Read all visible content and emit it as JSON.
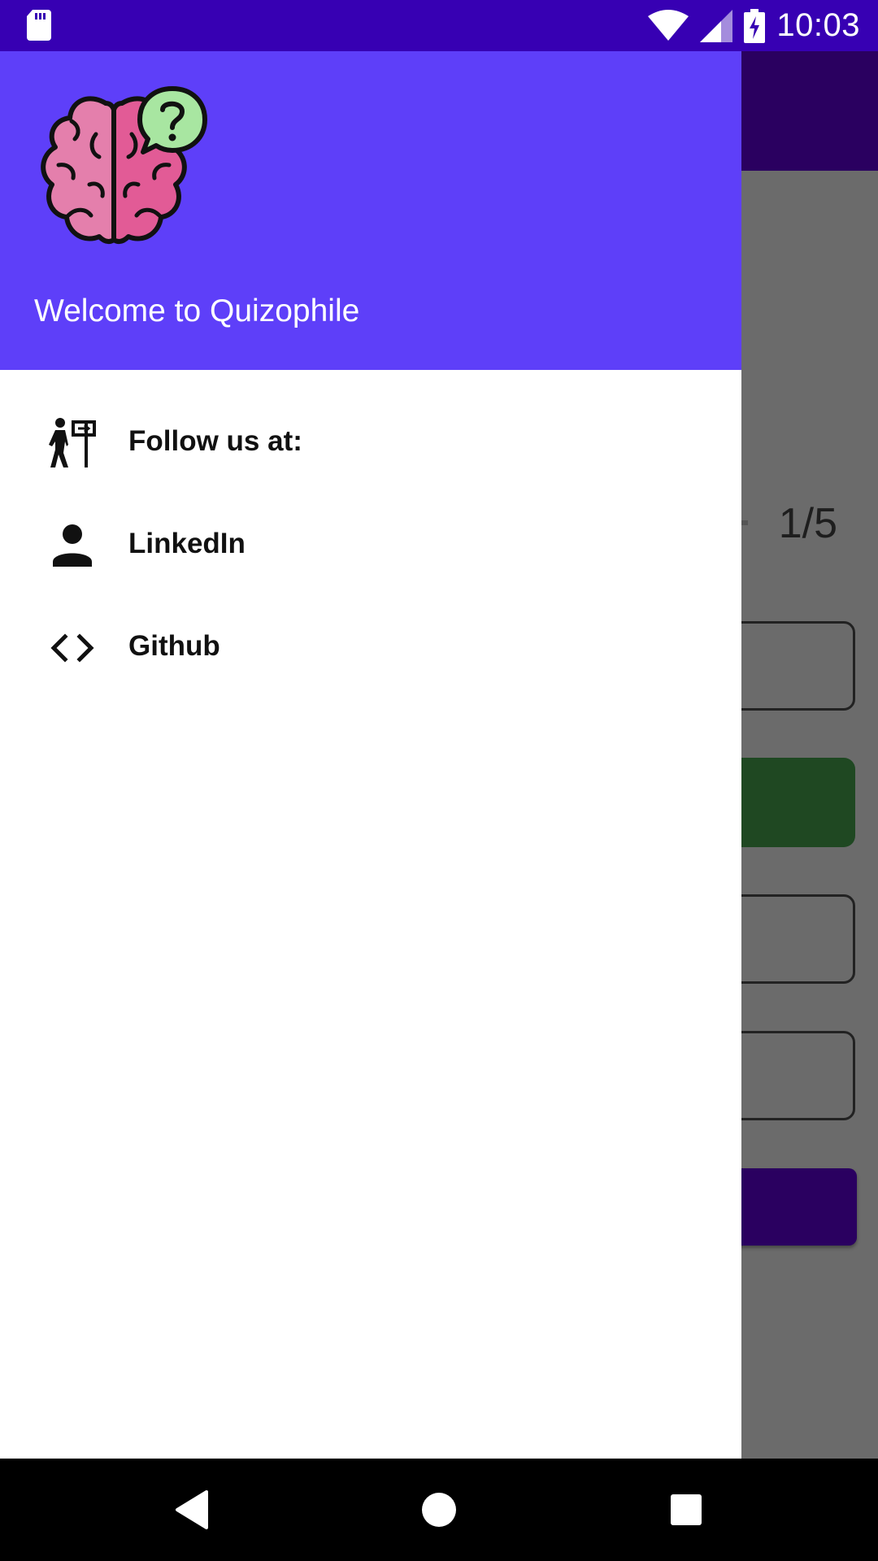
{
  "status_bar": {
    "time": "10:03",
    "icons": [
      "sd-card-icon",
      "wifi-icon",
      "signal-icon",
      "battery-charging-icon"
    ],
    "background": "#3700b3"
  },
  "background_screen": {
    "question_counter": "1/5",
    "toolbar_color": "#2a0060",
    "correct_option_color": "#1f4822",
    "submit_color": "#2a0060"
  },
  "drawer": {
    "header": {
      "logo": "brain-question-logo",
      "title": "Welcome to Quizophile",
      "background": "#5e3ff9"
    },
    "items": [
      {
        "label": "Follow us at:",
        "icon": "person-signpost-icon"
      },
      {
        "label": "LinkedIn",
        "icon": "person-icon"
      },
      {
        "label": "Github",
        "icon": "code-icon"
      }
    ]
  },
  "nav_bar": {
    "buttons": [
      "back-icon",
      "home-icon",
      "recents-icon"
    ]
  }
}
